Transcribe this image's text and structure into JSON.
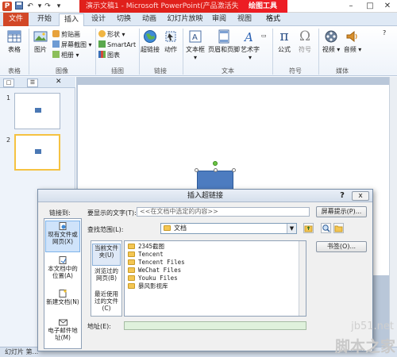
{
  "titlebar": {
    "app_icon": "P",
    "title": "演示文稿1 - Microsoft PowerPoint(产品激活失败)",
    "context_tool": "绘图工具",
    "icons": [
      "powerpoint-icon",
      "save-icon",
      "undo-icon",
      "redo-icon",
      "customize-icon"
    ],
    "window_buttons": [
      "minimize",
      "maximize",
      "close"
    ]
  },
  "tabs": {
    "file": "文件",
    "home": "开始",
    "insert": "插入",
    "design": "设计",
    "transitions": "切换",
    "animations": "动画",
    "slideshow": "幻灯片放映",
    "review": "审阅",
    "view": "视图",
    "format": "格式"
  },
  "ribbon": {
    "table": "表格",
    "picture": "图片",
    "clipart": "剪贴画",
    "screenshot": "屏幕截图",
    "album": "相册",
    "shapes": "形状",
    "smartart": "SmartArt",
    "chart": "图表",
    "hyperlink": "超链接",
    "action": "动作",
    "textbox": "文本框",
    "header_footer": "页眉和页脚",
    "wordart": "艺术字",
    "formula": "公式",
    "symbol": "符号",
    "video": "视频",
    "audio": "音频",
    "groups": {
      "tables": "表格",
      "images": "图像",
      "illustrations": "插图",
      "links": "链接",
      "text": "文本",
      "symbols": "符号",
      "media": "媒体"
    }
  },
  "left_panel": {
    "tab_slides": "□",
    "tab_outline": "☰",
    "slides": [
      {
        "num": "1"
      },
      {
        "num": "2"
      }
    ]
  },
  "statusbar": {
    "text": "幻灯片 第..."
  },
  "dialog": {
    "title": "插入超链接",
    "help": "?",
    "close": "x",
    "link_to_label": "链接到:",
    "display_text_label": "要显示的文字(T):",
    "display_text_value": "<<在文档中选定的内容>>",
    "screentip_button": "屏幕提示(P)...",
    "look_in_label": "查找范围(L):",
    "look_in_value": "文档",
    "bookmark_button": "书签(O)...",
    "address_label": "地址(E):",
    "link_to_items": [
      "现有文件或网页(X)",
      "本文档中的位置(A)",
      "新建文档(N)",
      "电子邮件地址(M)"
    ],
    "places": [
      "当前文件夹(U)",
      "浏览过的网页(B)",
      "最近使用过的文件(C)"
    ],
    "files": [
      "2345截图",
      "Tencent",
      "Tencent Files",
      "WeChat Files",
      "Youku Files",
      "暴风影视库"
    ]
  },
  "watermark": {
    "top": "jb51.net",
    "bottom": "脚本之家"
  },
  "colors": {
    "file_tab": "#d24726",
    "context_red": "#ed1c24",
    "shape_fill": "#4d7cc0"
  }
}
